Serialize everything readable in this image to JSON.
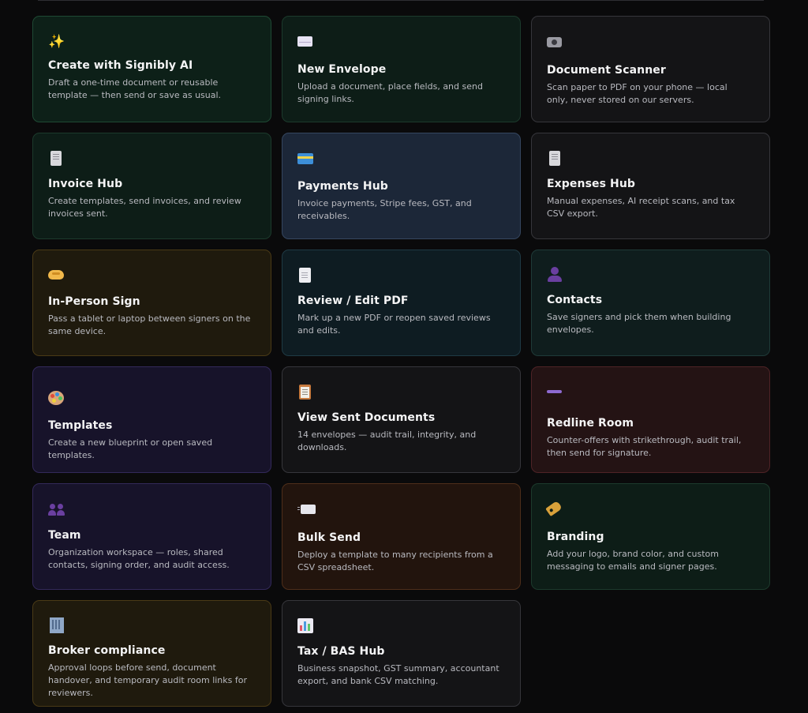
{
  "colors": {
    "page_background": "#0a0a0b",
    "title_text": "#f4f4f5",
    "description_text": "#b9bac0"
  },
  "cards": [
    {
      "id": "create-with-signibly-ai",
      "icon": "sparkles-icon",
      "title": "Create with Signibly AI",
      "description": "Draft a one-time document or reusable template — then send or save as usual."
    },
    {
      "id": "new-envelope",
      "icon": "envelope-icon",
      "title": "New Envelope",
      "description": "Upload a document, place fields, and send signing links."
    },
    {
      "id": "document-scanner",
      "icon": "camera-icon",
      "title": "Document Scanner",
      "description": "Scan paper to PDF on your phone — local only, never stored on our servers."
    },
    {
      "id": "invoice-hub",
      "icon": "receipt-icon",
      "title": "Invoice Hub",
      "description": "Create templates, send invoices, and review invoices sent."
    },
    {
      "id": "payments-hub",
      "icon": "credit-card-icon",
      "title": "Payments Hub",
      "description": "Invoice payments, Stripe fees, GST, and receivables."
    },
    {
      "id": "expenses-hub",
      "icon": "receipt-icon",
      "title": "Expenses Hub",
      "description": "Manual expenses, AI receipt scans, and tax CSV export."
    },
    {
      "id": "in-person-sign",
      "icon": "handshake-icon",
      "title": "In-Person Sign",
      "description": "Pass a tablet or laptop between signers on the same device."
    },
    {
      "id": "review-edit-pdf",
      "icon": "page-icon",
      "title": "Review / Edit PDF",
      "description": "Mark up a new PDF or reopen saved reviews and edits."
    },
    {
      "id": "contacts",
      "icon": "person-icon",
      "title": "Contacts",
      "description": "Save signers and pick them when building envelopes."
    },
    {
      "id": "templates",
      "icon": "palette-icon",
      "title": "Templates",
      "description": "Create a new blueprint or open saved templates."
    },
    {
      "id": "view-sent-documents",
      "icon": "clipboard-icon",
      "title": "View Sent Documents",
      "description": "14 envelopes — audit trail, integrity, and downloads."
    },
    {
      "id": "redline-room",
      "icon": "minus-icon",
      "title": "Redline Room",
      "description": "Counter-offers with strikethrough, audit trail, then send for signature."
    },
    {
      "id": "team",
      "icon": "people-icon",
      "title": "Team",
      "description": "Organization workspace — roles, shared contacts, signing order, and audit access."
    },
    {
      "id": "bulk-send",
      "icon": "incoming-envelope-icon",
      "title": "Bulk Send",
      "description": "Deploy a template to many recipients from a CSV spreadsheet."
    },
    {
      "id": "branding",
      "icon": "tag-icon",
      "title": "Branding",
      "description": "Add your logo, brand color, and custom messaging to emails and signer pages."
    },
    {
      "id": "broker-compliance",
      "icon": "office-building-icon",
      "title": "Broker compliance",
      "description": "Approval loops before send, document handover, and temporary audit room links for reviewers."
    },
    {
      "id": "tax-bas-hub",
      "icon": "bar-chart-icon",
      "title": "Tax / BAS Hub",
      "description": "Business snapshot, GST summary, accountant export, and bank CSV matching."
    }
  ]
}
